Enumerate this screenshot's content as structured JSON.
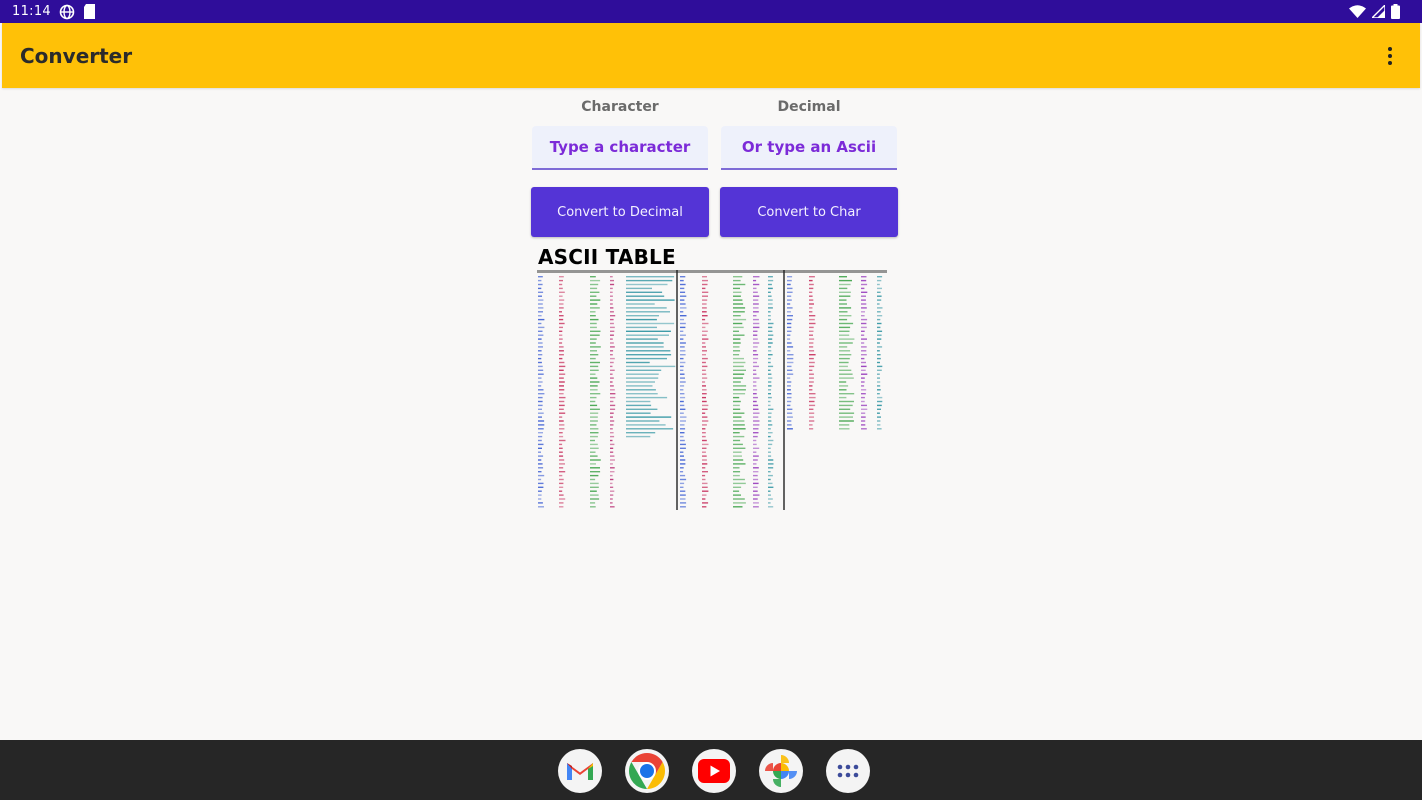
{
  "status_bar": {
    "time": "11:14",
    "left_icons": [
      "vpn-globe-icon",
      "sd-card-icon"
    ],
    "right_icons": [
      "wifi-icon",
      "cell-signal-icon",
      "battery-icon"
    ],
    "background": "#2f0d9a"
  },
  "app_bar": {
    "title": "Converter",
    "menu_icon": "overflow-menu-icon",
    "background": "#ffc107"
  },
  "converter": {
    "character": {
      "label": "Character",
      "placeholder": "Type a character",
      "value": "",
      "button_label": "Convert to Decimal"
    },
    "decimal": {
      "label": "Decimal",
      "placeholder": "Or type an Ascii",
      "value": "",
      "button_label": "Convert to Char"
    },
    "accent_color": "#5434d6"
  },
  "ascii_table": {
    "title": "ASCII TABLE"
  },
  "dock": {
    "apps": [
      {
        "name": "Gmail",
        "icon": "gmail-icon"
      },
      {
        "name": "Chrome",
        "icon": "chrome-icon"
      },
      {
        "name": "YouTube",
        "icon": "youtube-icon"
      },
      {
        "name": "Photos",
        "icon": "photos-icon"
      },
      {
        "name": "App drawer",
        "icon": "app-drawer-icon"
      }
    ]
  }
}
